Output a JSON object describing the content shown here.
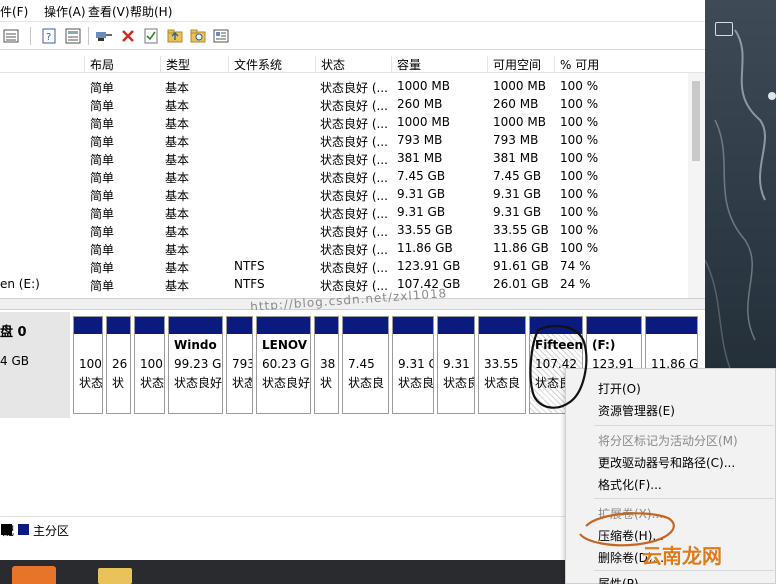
{
  "menu": {
    "file_label": "件(F)",
    "action_label": "操作(A)",
    "view_label": "查看(V)",
    "help_label": "帮助(H)"
  },
  "columns": [
    "布局",
    "类型",
    "文件系统",
    "状态",
    "容量",
    "可用空间",
    "% 可用"
  ],
  "rows": [
    {
      "name": "",
      "layout": "简单",
      "type": "基本",
      "fs": "",
      "status": "状态良好 (...",
      "capacity": "1000 MB",
      "free": "1000 MB",
      "pct": "100 %"
    },
    {
      "name": "",
      "layout": "简单",
      "type": "基本",
      "fs": "",
      "status": "状态良好 (...",
      "capacity": "260 MB",
      "free": "260 MB",
      "pct": "100 %"
    },
    {
      "name": "",
      "layout": "简单",
      "type": "基本",
      "fs": "",
      "status": "状态良好 (...",
      "capacity": "1000 MB",
      "free": "1000 MB",
      "pct": "100 %"
    },
    {
      "name": "",
      "layout": "简单",
      "type": "基本",
      "fs": "",
      "status": "状态良好 (...",
      "capacity": "793 MB",
      "free": "793 MB",
      "pct": "100 %"
    },
    {
      "name": "",
      "layout": "简单",
      "type": "基本",
      "fs": "",
      "status": "状态良好 (...",
      "capacity": "381 MB",
      "free": "381 MB",
      "pct": "100 %"
    },
    {
      "name": "",
      "layout": "简单",
      "type": "基本",
      "fs": "",
      "status": "状态良好 (...",
      "capacity": "7.45 GB",
      "free": "7.45 GB",
      "pct": "100 %"
    },
    {
      "name": "",
      "layout": "简单",
      "type": "基本",
      "fs": "",
      "status": "状态良好 (...",
      "capacity": "9.31 GB",
      "free": "9.31 GB",
      "pct": "100 %"
    },
    {
      "name": "",
      "layout": "简单",
      "type": "基本",
      "fs": "",
      "status": "状态良好 (...",
      "capacity": "9.31 GB",
      "free": "9.31 GB",
      "pct": "100 %"
    },
    {
      "name": "",
      "layout": "简单",
      "type": "基本",
      "fs": "",
      "status": "状态良好 (...",
      "capacity": "33.55 GB",
      "free": "33.55 GB",
      "pct": "100 %"
    },
    {
      "name": "",
      "layout": "简单",
      "type": "基本",
      "fs": "",
      "status": "状态良好 (...",
      "capacity": "11.86 GB",
      "free": "11.86 GB",
      "pct": "100 %"
    },
    {
      "name": "",
      "layout": "简单",
      "type": "基本",
      "fs": "NTFS",
      "status": "状态良好 (...",
      "capacity": "123.91 GB",
      "free": "91.61 GB",
      "pct": "74 %"
    },
    {
      "name": "en (E:)",
      "layout": "简单",
      "type": "基本",
      "fs": "NTFS",
      "status": "状态良好 (...",
      "capacity": "107.42 GB",
      "free": "26.01 GB",
      "pct": "24 %"
    }
  ],
  "watermark": "http://blog.csdn.net/zxl1018",
  "disk": {
    "label": "盘 0",
    "size": "4 GB"
  },
  "partitions": [
    {
      "name": "",
      "size": "100",
      "status": "状态"
    },
    {
      "name": "",
      "size": "26",
      "status": "状"
    },
    {
      "name": "",
      "size": "100",
      "status": "状态"
    },
    {
      "name": "Windo",
      "size": "99.23 G",
      "status": "状态良好"
    },
    {
      "name": "",
      "size": "793",
      "status": "状态"
    },
    {
      "name": "LENOV",
      "size": "60.23 G",
      "status": "状态良好"
    },
    {
      "name": "",
      "size": "38",
      "status": "状"
    },
    {
      "name": "",
      "size": "7.45",
      "status": "状态良"
    },
    {
      "name": "",
      "size": "9.31 G",
      "status": "状态良"
    },
    {
      "name": "",
      "size": "9.31 G",
      "status": "状态良"
    },
    {
      "name": "",
      "size": "33.55",
      "status": "状态良"
    },
    {
      "name": "Fifteen",
      "size": "107.42",
      "status": "状态良"
    },
    {
      "name": "(F:)",
      "size": "123.91",
      "status": "状态良"
    },
    {
      "name": "",
      "size": "11.86 G",
      "status": "状态良"
    }
  ],
  "legend": {
    "unallocated_label": "配",
    "primary_label": "主分区"
  },
  "context_menu": {
    "open": "打开(O)",
    "explorer": "资源管理器(E)",
    "mark_active": "将分区标记为活动分区(M)",
    "change_letter": "更改驱动器号和路径(C)...",
    "format": "格式化(F)...",
    "extend": "扩展卷(X)...",
    "shrink": "压缩卷(H)...",
    "delete": "删除卷(D)...",
    "properties": "属性(P)"
  },
  "brand_text": "云南龙网",
  "colors": {
    "primary_partition": "#0a1a7e",
    "annotation": "#c8641e"
  }
}
